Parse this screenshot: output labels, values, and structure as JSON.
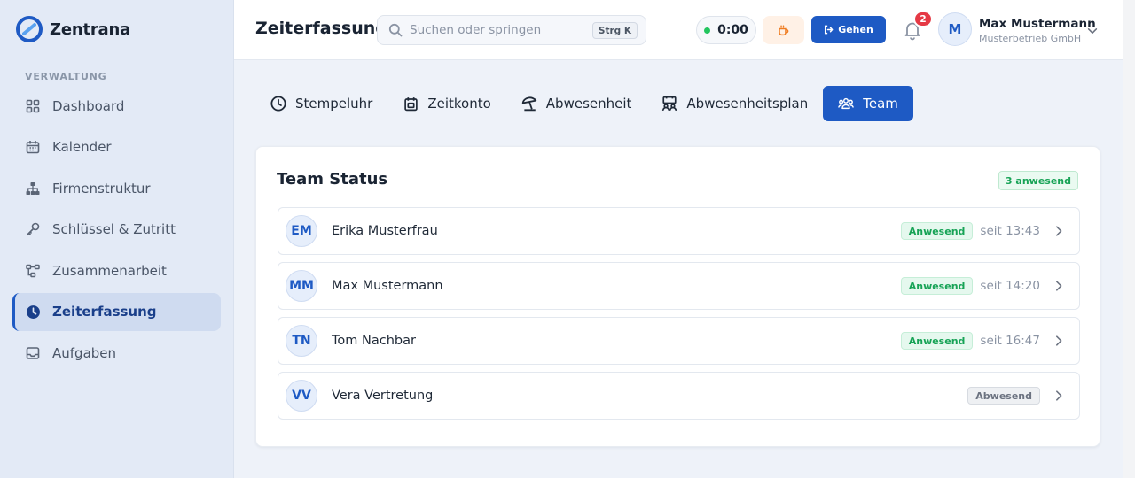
{
  "brand": {
    "name": "Zentrana"
  },
  "sidebar": {
    "section_label": "VERWALTUNG",
    "items": [
      {
        "label": "Dashboard",
        "icon": "grid-icon"
      },
      {
        "label": "Kalender",
        "icon": "calendar-icon"
      },
      {
        "label": "Firmenstruktur",
        "icon": "org-chart-icon"
      },
      {
        "label": "Schlüssel & Zutritt",
        "icon": "key-icon"
      },
      {
        "label": "Zusammenarbeit",
        "icon": "workflow-icon"
      },
      {
        "label": "Zeiterfassung",
        "icon": "clock-icon",
        "active": true
      },
      {
        "label": "Aufgaben",
        "icon": "inbox-icon"
      }
    ]
  },
  "header": {
    "title": "Zeiterfassung",
    "search": {
      "placeholder": "Suchen oder springen",
      "shortcut": "Strg K"
    },
    "timer": "0:00",
    "leave_label": "Gehen",
    "notifications": "2",
    "user": {
      "initial": "M",
      "name": "Max Mustermann",
      "company": "Musterbetrieb GmbH"
    }
  },
  "tabs": [
    {
      "label": "Stempeluhr",
      "icon": "clock-icon"
    },
    {
      "label": "Zeitkonto",
      "icon": "calendar-account-icon"
    },
    {
      "label": "Abwesenheit",
      "icon": "beach-umbrella-icon"
    },
    {
      "label": "Abwesenheitsplan",
      "icon": "team-plan-icon"
    },
    {
      "label": "Team",
      "icon": "users-icon",
      "active": true
    }
  ],
  "team_status": {
    "title": "Team Status",
    "present_count": "3 anwesend",
    "members": [
      {
        "initials": "EM",
        "name": "Erika Musterfrau",
        "status": "Anwesend",
        "state": "present",
        "since": "seit 13:43"
      },
      {
        "initials": "MM",
        "name": "Max Mustermann",
        "status": "Anwesend",
        "state": "present",
        "since": "seit 14:20"
      },
      {
        "initials": "TN",
        "name": "Tom Nachbar",
        "status": "Anwesend",
        "state": "present",
        "since": "seit 16:47"
      },
      {
        "initials": "VV",
        "name": "Vera Vertretung",
        "status": "Abwesend",
        "state": "absent",
        "since": ""
      }
    ]
  },
  "colors": {
    "accent": "#1e5ac4",
    "present": "#17a356",
    "badge": "#e53945"
  }
}
